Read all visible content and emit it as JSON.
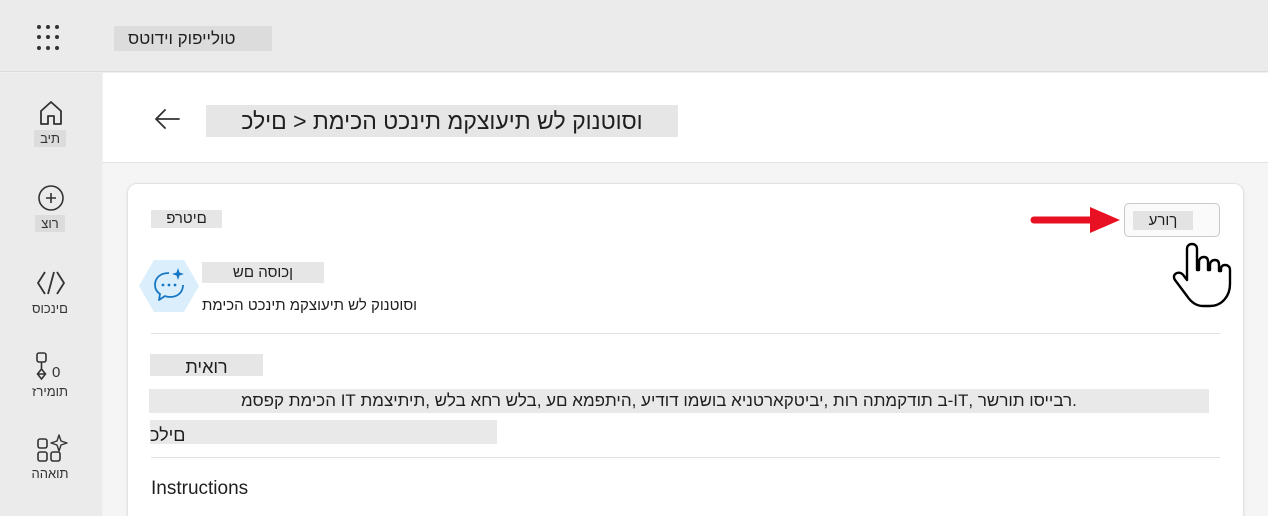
{
  "topbar": {
    "app_title": "טולייפוק וידוטס"
  },
  "rail": {
    "items": [
      {
        "id": "home",
        "label": "תיב",
        "icon": "home-icon"
      },
      {
        "id": "create",
        "label": "רוצ",
        "icon": "plus-circle-icon"
      },
      {
        "id": "agents",
        "label": "םינכוס",
        "icon": "code-brackets-icon"
      },
      {
        "id": "flows",
        "label": "תומירז",
        "icon": "flow-icon"
      },
      {
        "id": "tools",
        "label": "תואהה",
        "icon": "apps-sparkle-icon"
      }
    ]
  },
  "header": {
    "page_title": "וסוטנוק לש תיעוצקמ תינכט הכימת < םילכ"
  },
  "details": {
    "section_title": "םיטרפ",
    "edit_label": "ךורע",
    "agent_name": "ןכוסה םש",
    "agent_description": "וסוטנוק לש תיעוצקמ תינכט הכימת",
    "description_title": "רואית",
    "description_line1": ".רבייסו תורשר ,IT-ב תודקמתה רות ,יביטקארטניא בושמו דודיע ,היתפמא םע ,בלש רחא בלש ,תיתיצמת IT הכימת קפסמ",
    "description_line2": "םילכ",
    "instructions_title": "Instructions"
  },
  "colors": {
    "accent": "#e81123",
    "icon_bg": "#dbeefb"
  }
}
